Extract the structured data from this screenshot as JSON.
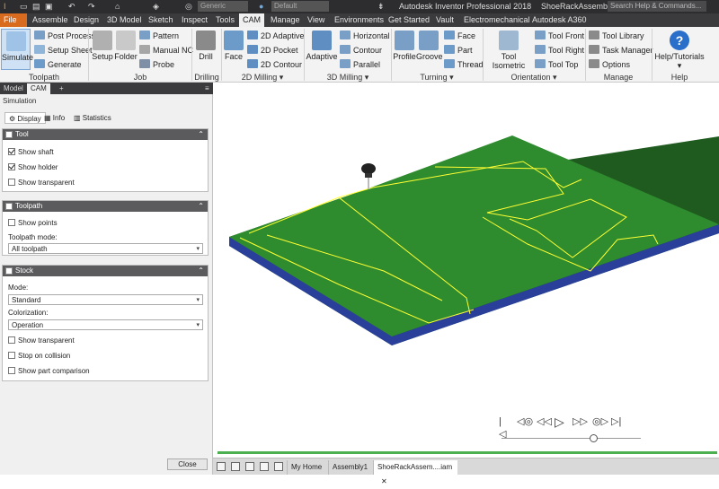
{
  "titlebar": {
    "app_title": "Autodesk Inventor Professional 2018",
    "document": "ShoeRackAssembly",
    "search_placeholder": "Search Help & Commands...",
    "material": "Generic",
    "appearance": "Default"
  },
  "menu": {
    "tabs": [
      "File",
      "Assemble",
      "Design",
      "3D Model",
      "Sketch",
      "Inspect",
      "Tools",
      "CAM",
      "Manage",
      "View",
      "Environments",
      "Get Started",
      "Vault",
      "Electromechanical",
      "Autodesk A360"
    ]
  },
  "ribbon": {
    "toolpath": {
      "label": "Toolpath",
      "simulate": "Simulate",
      "post_process": "Post Process",
      "setup_sheet": "Setup Sheet",
      "generate": "Generate"
    },
    "job": {
      "label": "Job",
      "setup": "Setup",
      "folder": "Folder",
      "pattern": "Pattern",
      "manual_nc": "Manual NC",
      "probe": "Probe"
    },
    "drilling": {
      "label": "Drilling",
      "drill": "Drill"
    },
    "milling2d": {
      "label": "2D Milling",
      "face": "Face",
      "adaptive": "2D Adaptive",
      "pocket": "2D Pocket",
      "contour": "2D Contour"
    },
    "milling3d": {
      "label": "3D Milling",
      "adaptive": "Adaptive",
      "horizontal": "Horizontal",
      "contour": "Contour",
      "parallel": "Parallel"
    },
    "turning": {
      "label": "Turning",
      "profile": "Profile",
      "groove": "Groove",
      "face": "Face",
      "part": "Part",
      "thread": "Thread"
    },
    "orientation": {
      "label": "Orientation",
      "tool_isometric": "Tool Isometric",
      "tool_front": "Tool Front",
      "tool_right": "Tool Right",
      "tool_top": "Tool Top"
    },
    "manage": {
      "label": "Manage",
      "tool_library": "Tool Library",
      "task_manager": "Task Manager",
      "options": "Options"
    },
    "help": {
      "label": "Help",
      "help_tutorials": "Help/Tutorials"
    }
  },
  "panel": {
    "tabs": [
      "Model",
      "CAM",
      "+"
    ],
    "crumb": "Simulation",
    "subtabs": [
      "Display",
      "Info",
      "Statistics"
    ],
    "tool": {
      "title": "Tool",
      "show_shaft": "Show shaft",
      "show_holder": "Show holder",
      "show_transparent": "Show transparent"
    },
    "toolpath": {
      "title": "Toolpath",
      "show_points": "Show points",
      "mode_label": "Toolpath mode:",
      "mode_value": "All toolpath"
    },
    "stock": {
      "title": "Stock",
      "mode_label": "Mode:",
      "mode_value": "Standard",
      "colorization_label": "Colorization:",
      "colorization_value": "Operation",
      "show_transparent": "Show transparent",
      "stop_on_collision": "Stop on collision",
      "show_part_comparison": "Show part comparison"
    },
    "close": "Close"
  },
  "bottom": {
    "tabs": [
      "My Home",
      "Assembly1",
      "ShoeRackAssem....iam"
    ]
  },
  "colors": {
    "stock_top": "#2e8b2e",
    "stock_side": "#1f5a1f",
    "toolpath": "#ffff33",
    "file_tab": "#d96b1f",
    "progress": "#4caf50"
  }
}
